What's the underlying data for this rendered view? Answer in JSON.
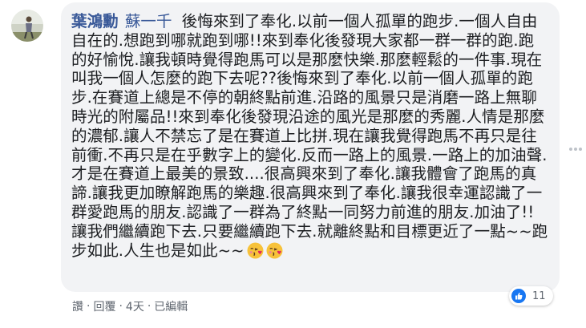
{
  "comment": {
    "author": "葉鴻勳",
    "tagged_user": "蘇一千",
    "text": "後悔來到了奉化.以前一個人孤單的跑步.一個人自由自在的.想跑到哪就跑到哪!!來到奉化後發現大家都一群一群的跑.跑的好愉悅.讓我頓時覺得跑馬可以是那麼快樂.那麼輕鬆的一件事.現在叫我一個人怎麼的跑下去呢??後悔來到了奉化.以前一個人孤單的跑步.在賽道上總是不停的朝終點前進.沿路的風景只是消磨一路上無聊時光的附屬品!!來到奉化後發現沿途的風光是那麼的秀麗.人情是那麼的濃郁.讓人不禁忘了是在賽道上比拼.現在讓我覺得跑馬不再只是往前衝.不再只是在乎數字上的變化.反而一路上的風景.一路上的加油聲.才是在賽道上最美的景致....很高興來到了奉化.讓我體會了跑馬的真諦.讓我更加瞭解跑馬的樂趣.很高興來到了奉化.讓我很幸運認識了一群愛跑馬的朋友.認識了一群為了終點一同努力前進的朋友.加油了!!讓我們繼續跑下去.只要繼續跑下去.就離終點和目標更近了一點~~跑步如此.人生也是如此~~",
    "emojis": [
      "kissing-heart-emoji",
      "kissing-heart-emoji"
    ],
    "reaction_count": "11"
  },
  "actions": {
    "like": "讚",
    "separator": "·",
    "reply": "回覆",
    "time": "4天",
    "edited": "已編輯"
  },
  "colors": {
    "name": "#385898",
    "bubble": "#f2f3f5",
    "like": "#1877f2",
    "meta": "#606770"
  }
}
